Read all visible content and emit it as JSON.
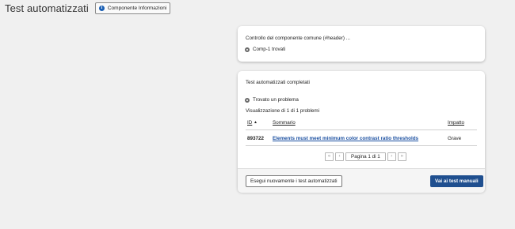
{
  "header": {
    "title": "Test automatizzati",
    "info_button": "Componente Informazioni"
  },
  "check_card": {
    "heading": "Controllo del componente comune (#header) ...",
    "status_text": "Comp-1 trovati"
  },
  "results_card": {
    "heading": "Test automatizzati completati",
    "status_text": "Trovato un problema",
    "showing": "Visualizzazione di 1 di 1 problemi",
    "columns": {
      "id": "ID",
      "sort_indicator": "▲",
      "summary": "Sommario",
      "impact": "Impatto"
    },
    "rows": [
      {
        "id": "893722",
        "summary": "Elements must meet minimum color contrast ratio thresholds",
        "impact": "Grave"
      }
    ],
    "pagination": {
      "label": "Pagina 1 di 1",
      "first_icon": "double-chevron-left",
      "prev_icon": "chevron-left",
      "next_icon": "chevron-right",
      "last_icon": "double-chevron-right"
    },
    "rerun_button": "Esegui nuovamente i test automatizzati",
    "manual_button": "Vai ai test manuali"
  },
  "colors": {
    "background": "#f0f0f0",
    "primary_button": "#1f4f8f",
    "link": "#1a4fa0",
    "info_icon": "#1a5fb4"
  }
}
